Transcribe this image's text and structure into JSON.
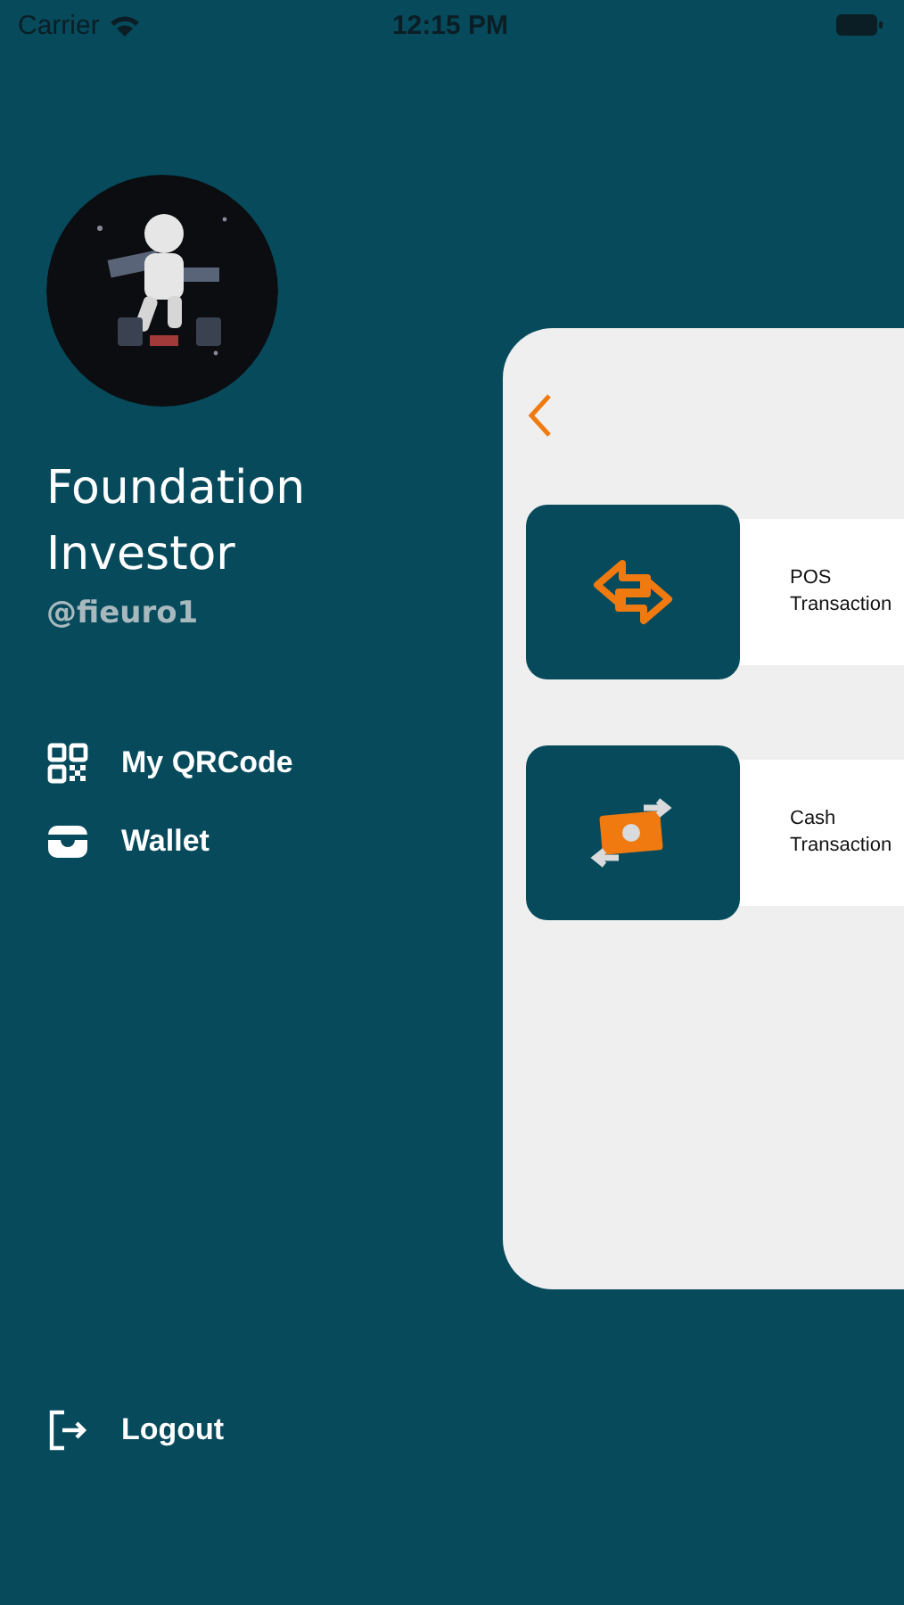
{
  "status_bar": {
    "carrier": "Carrier",
    "time": "12:15 PM"
  },
  "profile": {
    "name": "Foundation Investor",
    "handle": "@fieuro1"
  },
  "menu": [
    {
      "kind": "qr",
      "label": "My QRCode"
    },
    {
      "kind": "wallet",
      "label": "Wallet"
    }
  ],
  "logout": {
    "label": "Logout"
  },
  "panel": {
    "items": [
      {
        "kind": "pos",
        "label": "POS Transaction"
      },
      {
        "kind": "cash",
        "label": "Cash Transaction"
      }
    ]
  }
}
